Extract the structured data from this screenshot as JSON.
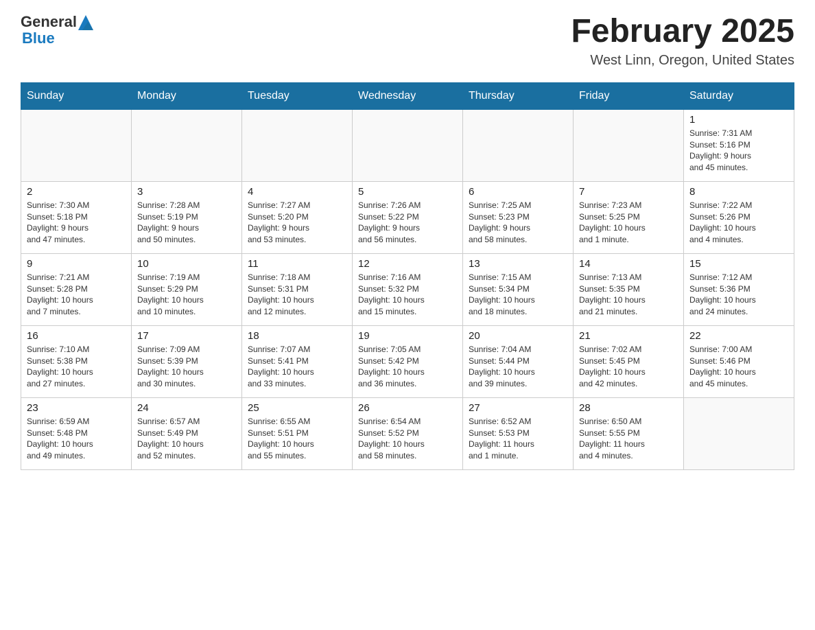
{
  "header": {
    "logo_general": "General",
    "logo_blue": "Blue",
    "month_year": "February 2025",
    "location": "West Linn, Oregon, United States"
  },
  "days_of_week": [
    "Sunday",
    "Monday",
    "Tuesday",
    "Wednesday",
    "Thursday",
    "Friday",
    "Saturday"
  ],
  "weeks": [
    [
      {
        "day": "",
        "info": ""
      },
      {
        "day": "",
        "info": ""
      },
      {
        "day": "",
        "info": ""
      },
      {
        "day": "",
        "info": ""
      },
      {
        "day": "",
        "info": ""
      },
      {
        "day": "",
        "info": ""
      },
      {
        "day": "1",
        "info": "Sunrise: 7:31 AM\nSunset: 5:16 PM\nDaylight: 9 hours\nand 45 minutes."
      }
    ],
    [
      {
        "day": "2",
        "info": "Sunrise: 7:30 AM\nSunset: 5:18 PM\nDaylight: 9 hours\nand 47 minutes."
      },
      {
        "day": "3",
        "info": "Sunrise: 7:28 AM\nSunset: 5:19 PM\nDaylight: 9 hours\nand 50 minutes."
      },
      {
        "day": "4",
        "info": "Sunrise: 7:27 AM\nSunset: 5:20 PM\nDaylight: 9 hours\nand 53 minutes."
      },
      {
        "day": "5",
        "info": "Sunrise: 7:26 AM\nSunset: 5:22 PM\nDaylight: 9 hours\nand 56 minutes."
      },
      {
        "day": "6",
        "info": "Sunrise: 7:25 AM\nSunset: 5:23 PM\nDaylight: 9 hours\nand 58 minutes."
      },
      {
        "day": "7",
        "info": "Sunrise: 7:23 AM\nSunset: 5:25 PM\nDaylight: 10 hours\nand 1 minute."
      },
      {
        "day": "8",
        "info": "Sunrise: 7:22 AM\nSunset: 5:26 PM\nDaylight: 10 hours\nand 4 minutes."
      }
    ],
    [
      {
        "day": "9",
        "info": "Sunrise: 7:21 AM\nSunset: 5:28 PM\nDaylight: 10 hours\nand 7 minutes."
      },
      {
        "day": "10",
        "info": "Sunrise: 7:19 AM\nSunset: 5:29 PM\nDaylight: 10 hours\nand 10 minutes."
      },
      {
        "day": "11",
        "info": "Sunrise: 7:18 AM\nSunset: 5:31 PM\nDaylight: 10 hours\nand 12 minutes."
      },
      {
        "day": "12",
        "info": "Sunrise: 7:16 AM\nSunset: 5:32 PM\nDaylight: 10 hours\nand 15 minutes."
      },
      {
        "day": "13",
        "info": "Sunrise: 7:15 AM\nSunset: 5:34 PM\nDaylight: 10 hours\nand 18 minutes."
      },
      {
        "day": "14",
        "info": "Sunrise: 7:13 AM\nSunset: 5:35 PM\nDaylight: 10 hours\nand 21 minutes."
      },
      {
        "day": "15",
        "info": "Sunrise: 7:12 AM\nSunset: 5:36 PM\nDaylight: 10 hours\nand 24 minutes."
      }
    ],
    [
      {
        "day": "16",
        "info": "Sunrise: 7:10 AM\nSunset: 5:38 PM\nDaylight: 10 hours\nand 27 minutes."
      },
      {
        "day": "17",
        "info": "Sunrise: 7:09 AM\nSunset: 5:39 PM\nDaylight: 10 hours\nand 30 minutes."
      },
      {
        "day": "18",
        "info": "Sunrise: 7:07 AM\nSunset: 5:41 PM\nDaylight: 10 hours\nand 33 minutes."
      },
      {
        "day": "19",
        "info": "Sunrise: 7:05 AM\nSunset: 5:42 PM\nDaylight: 10 hours\nand 36 minutes."
      },
      {
        "day": "20",
        "info": "Sunrise: 7:04 AM\nSunset: 5:44 PM\nDaylight: 10 hours\nand 39 minutes."
      },
      {
        "day": "21",
        "info": "Sunrise: 7:02 AM\nSunset: 5:45 PM\nDaylight: 10 hours\nand 42 minutes."
      },
      {
        "day": "22",
        "info": "Sunrise: 7:00 AM\nSunset: 5:46 PM\nDaylight: 10 hours\nand 45 minutes."
      }
    ],
    [
      {
        "day": "23",
        "info": "Sunrise: 6:59 AM\nSunset: 5:48 PM\nDaylight: 10 hours\nand 49 minutes."
      },
      {
        "day": "24",
        "info": "Sunrise: 6:57 AM\nSunset: 5:49 PM\nDaylight: 10 hours\nand 52 minutes."
      },
      {
        "day": "25",
        "info": "Sunrise: 6:55 AM\nSunset: 5:51 PM\nDaylight: 10 hours\nand 55 minutes."
      },
      {
        "day": "26",
        "info": "Sunrise: 6:54 AM\nSunset: 5:52 PM\nDaylight: 10 hours\nand 58 minutes."
      },
      {
        "day": "27",
        "info": "Sunrise: 6:52 AM\nSunset: 5:53 PM\nDaylight: 11 hours\nand 1 minute."
      },
      {
        "day": "28",
        "info": "Sunrise: 6:50 AM\nSunset: 5:55 PM\nDaylight: 11 hours\nand 4 minutes."
      },
      {
        "day": "",
        "info": ""
      }
    ]
  ]
}
